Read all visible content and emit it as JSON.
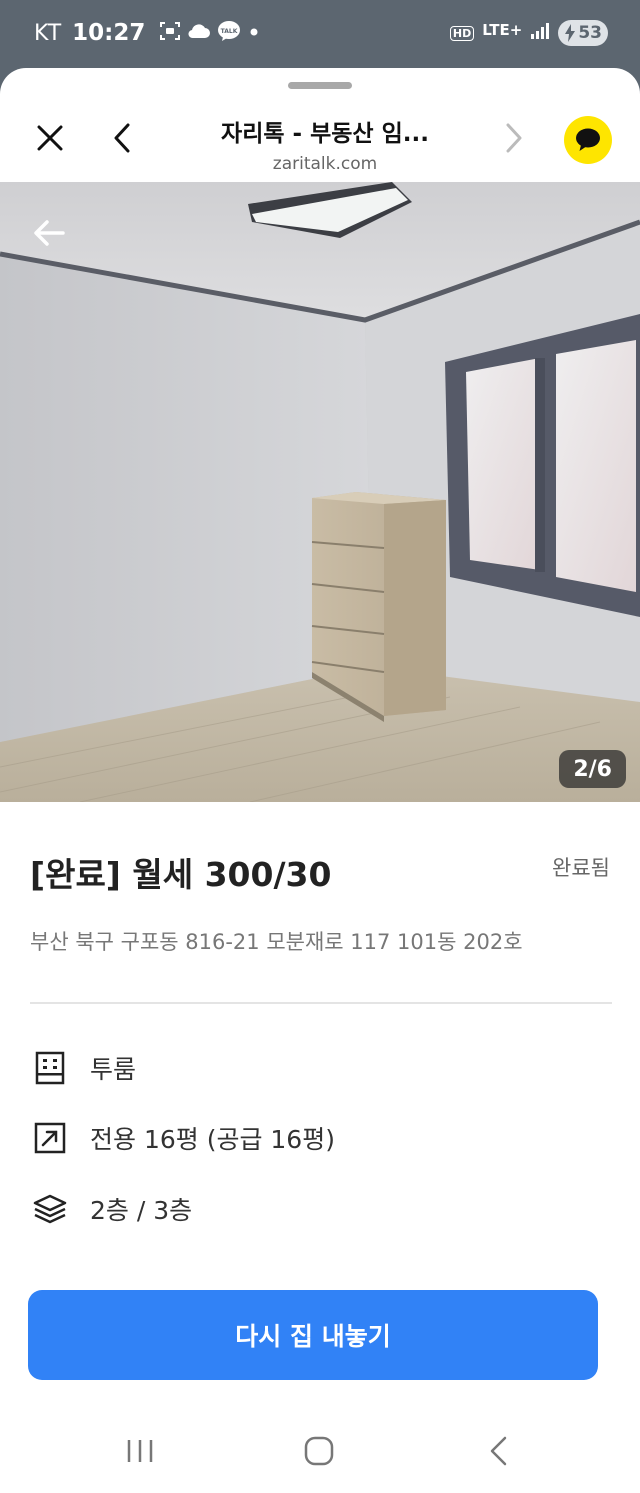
{
  "status_bar": {
    "carrier": "KT",
    "time": "10:27",
    "hd_label": "HD",
    "network_label": "LTE+",
    "battery_level": "53"
  },
  "browser": {
    "title": "자리톡 - 부동산 임...",
    "url": "zaritalk.com"
  },
  "photo": {
    "counter": "2/6"
  },
  "listing": {
    "title": "[완료] 월세 300/30",
    "status": "완료됨",
    "address": "부산 북구 구포동 816-21 모분재로 117 101동 202호"
  },
  "specs": [
    {
      "icon": "building-icon",
      "text": "투룸"
    },
    {
      "icon": "area-arrow-icon",
      "text": "전용 16평 (공급 16평)"
    },
    {
      "icon": "layers-icon",
      "text": "2층 / 3층"
    }
  ],
  "cta": {
    "label": "다시 집 내놓기"
  },
  "colors": {
    "accent": "#3182f6",
    "kakao_yellow": "#fee500",
    "status_bar_bg": "#5c6670"
  }
}
